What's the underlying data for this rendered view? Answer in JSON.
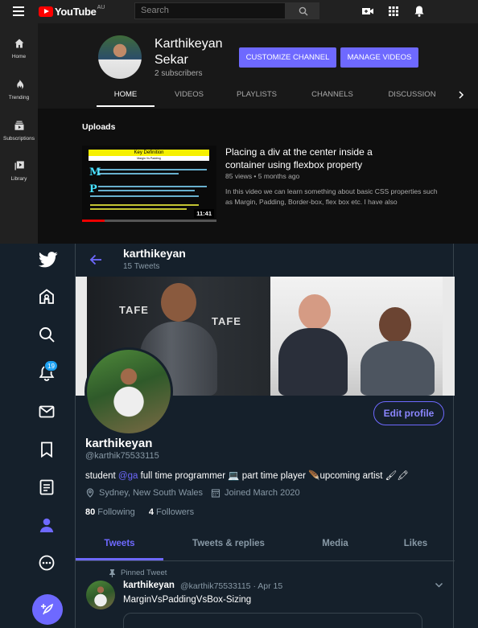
{
  "youtube": {
    "logo_text": "YouTube",
    "logo_country": "AU",
    "search_placeholder": "Search",
    "sidebar": [
      {
        "label": "Home",
        "icon": "home-icon"
      },
      {
        "label": "Trending",
        "icon": "flame-icon"
      },
      {
        "label": "Subscriptions",
        "icon": "subscriptions-icon"
      },
      {
        "label": "Library",
        "icon": "library-icon"
      }
    ],
    "channel": {
      "name": "Karthikeyan Sekar",
      "subscribers": "2 subscribers",
      "customize_label": "CUSTOMIZE CHANNEL",
      "manage_label": "MANAGE VIDEOS"
    },
    "tabs": [
      "HOME",
      "VIDEOS",
      "PLAYLISTS",
      "CHANNELS",
      "DISCUSSION"
    ],
    "uploads_title": "Uploads",
    "video": {
      "thumb_heading": "Key Definition",
      "thumb_sub": "Margin Vs Padding",
      "duration": "11:41",
      "title": "Placing a div at the center inside a container using flexbox property",
      "meta": "85 views • 5 months ago",
      "description": "In this video we can learn something about basic CSS properties such as Margin, Padding, Border-box, flex box etc. I have also"
    },
    "accent": "#6e69ff"
  },
  "twitter": {
    "header_name": "karthikeyan",
    "header_count": "15 Tweets",
    "notification_badge": "19",
    "edit_label": "Edit profile",
    "name": "karthikeyan",
    "handle": "@karthik75533115",
    "bio_pre": "student ",
    "bio_link": "@ga",
    "bio_post": "  full time programmer 💻 part time player 🪶upcoming artist 🖌🖍",
    "location": "Sydney, New South Wales",
    "joined": "Joined March 2020",
    "following_count": "80",
    "following_label": " Following",
    "followers_count": "4",
    "followers_label": " Followers",
    "tabs": [
      "Tweets",
      "Tweets & replies",
      "Media",
      "Likes"
    ],
    "pinned_label": "Pinned Tweet",
    "tweet": {
      "name": "karthikeyan",
      "handle_time": "@karthik75533115 · Apr 15",
      "text": "MarginVsPaddingVsBox-Sizing"
    },
    "banner_text": "TAFE",
    "accent": "#6e69ff",
    "background": "#15202b"
  }
}
